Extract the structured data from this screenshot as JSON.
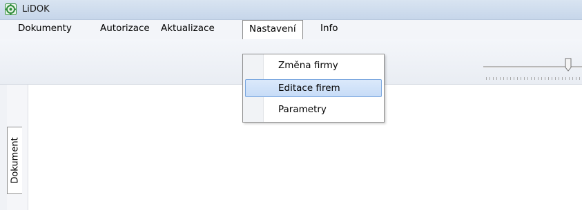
{
  "window": {
    "title": "LiDOK"
  },
  "menu": {
    "items": [
      {
        "label": "Dokumenty"
      },
      {
        "label": "Autorizace"
      },
      {
        "label": "Aktualizace"
      },
      {
        "label": "Nastavení"
      },
      {
        "label": "Info"
      }
    ],
    "open_menu": "Nastavení"
  },
  "dropdown": {
    "items": [
      {
        "label": "Změna firmy"
      },
      {
        "label": "Editace firem",
        "highlighted": true
      },
      {
        "label": "Parametry"
      }
    ]
  },
  "side_tabs": [
    {
      "label": "Dokument"
    }
  ],
  "colors": {
    "highlight": "#c7dcf7",
    "highlight_border": "#7aa7df",
    "title_bar": "#d9e4f1",
    "app_icon": "#2e8b3a"
  }
}
